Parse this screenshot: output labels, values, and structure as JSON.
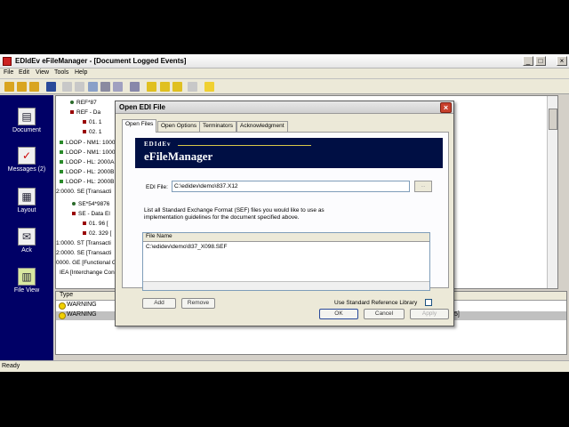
{
  "window": {
    "title": "EDIdEv eFileManager - [Document Logged Events]"
  },
  "menu": [
    "File",
    "Edit",
    "View",
    "Tools",
    "Help"
  ],
  "sidebar": [
    {
      "label": "Document",
      "icon": "document-icon"
    },
    {
      "label": "Messages (2)",
      "icon": "messages-icon"
    },
    {
      "label": "Layout",
      "icon": "layout-icon"
    },
    {
      "label": "Ack",
      "icon": "ack-icon"
    },
    {
      "label": "File View",
      "icon": "file-view-icon"
    }
  ],
  "tree_rows": [
    "REF*87",
    "REF - Da",
    "01. 1",
    "02. 1",
    "LOOP - NM1: 1000",
    "LOOP - NM1: 1000",
    "LOOP - HL: 2000A",
    "LOOP - HL: 2000B",
    "LOOP - HL: 2000B",
    "2:0000. SE [Transacti",
    "SE*54*9876",
    "SE - Data El",
    "01. 96  [",
    "02. 329  [",
    "1:0000. ST [Transacti",
    "2:0000. SE [Transacti",
    "0000. GE [Functional Gr",
    "IEA [Interchange Con"
  ],
  "log": {
    "header": "Type",
    "rows": [
      "WARNING",
      "WARNING"
    ],
    "tail": "5]"
  },
  "status": "Ready",
  "dialog": {
    "title": "Open EDI File",
    "tabs": [
      "Open Files",
      "Open Options",
      "Terminators",
      "Acknowledgment"
    ],
    "banner_top": "EDIdEv",
    "banner_main": "eFileManager",
    "edi_file_label": "EDI File:",
    "edi_file_value": "C:\\edidev\\demo\\837.X12",
    "browse_label": "...",
    "instructions": "List all Standard Exchange Format (SEF) files you would like to use as implementation guidelines for the document specified above.",
    "list_header": "File Name",
    "list_rows": [
      "C:\\edidev\\demo\\837_X098.SEF"
    ],
    "add_label": "Add",
    "remove_label": "Remove",
    "use_std_label": "Use Standard Reference Library",
    "ok_label": "OK",
    "cancel_label": "Cancel",
    "apply_label": "Apply"
  }
}
